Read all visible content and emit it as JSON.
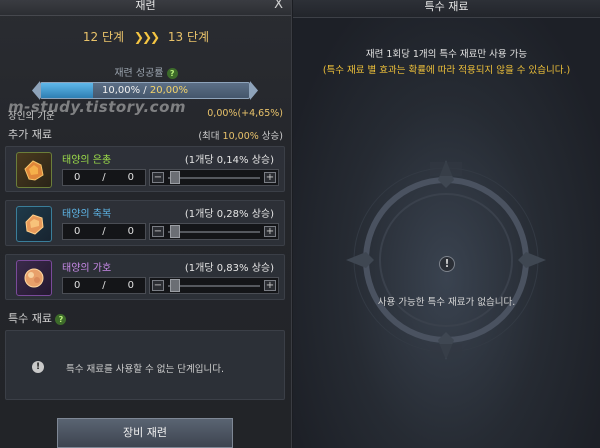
{
  "left_panel": {
    "title": "재련",
    "close_label": "X",
    "stage_from": "12 단계",
    "stage_arrows": "❯❯❯",
    "stage_to": "13 단계",
    "success_rate_label": "재련 성공률",
    "success_rate_current": "10,00%",
    "success_rate_separator": " / ",
    "success_rate_max": "20,00%",
    "success_rate_fill_fraction": 0.25,
    "watermark": "m-study.tistory.com",
    "artisan_label": "장인의 기운",
    "artisan_value": "0,00%(+4,65%)",
    "additional_title": "추가 재료",
    "additional_max_prefix": "(최대 ",
    "additional_max_value": "10,00%",
    "additional_max_suffix": " 상승)",
    "materials": [
      {
        "name": "태양의 은총",
        "rate": "(1개당 0,14% 상승)",
        "qty": "0",
        "sep": "/",
        "owned": "0",
        "color": "#9ee04a"
      },
      {
        "name": "태양의 축복",
        "rate": "(1개당 0,28% 상승)",
        "qty": "0",
        "sep": "/",
        "owned": "0",
        "color": "#5fb8ea"
      },
      {
        "name": "태양의 가호",
        "rate": "(1개당 0,83% 상승)",
        "qty": "0",
        "sep": "/",
        "owned": "0",
        "color": "#c88ae8"
      }
    ],
    "special_title": "특수 재료",
    "special_message": "특수 재료를 사용할 수 없는 단계입니다.",
    "equip_button": "장비 재련"
  },
  "right_panel": {
    "title": "특수 재료",
    "line1": "재련 1회당 1개의 특수 재료만 사용 가능",
    "line2": "(특수 재료 별 효과는 확률에 따라 적용되지 않을 수 있습니다.)",
    "empty_message": "사용 가능한 특수 재료가 없습니다.",
    "info_glyph": "!"
  },
  "colors": {
    "gold": "#e8c26a",
    "highlight_yellow": "#f0c23a",
    "green_text": "#9ee04a"
  }
}
